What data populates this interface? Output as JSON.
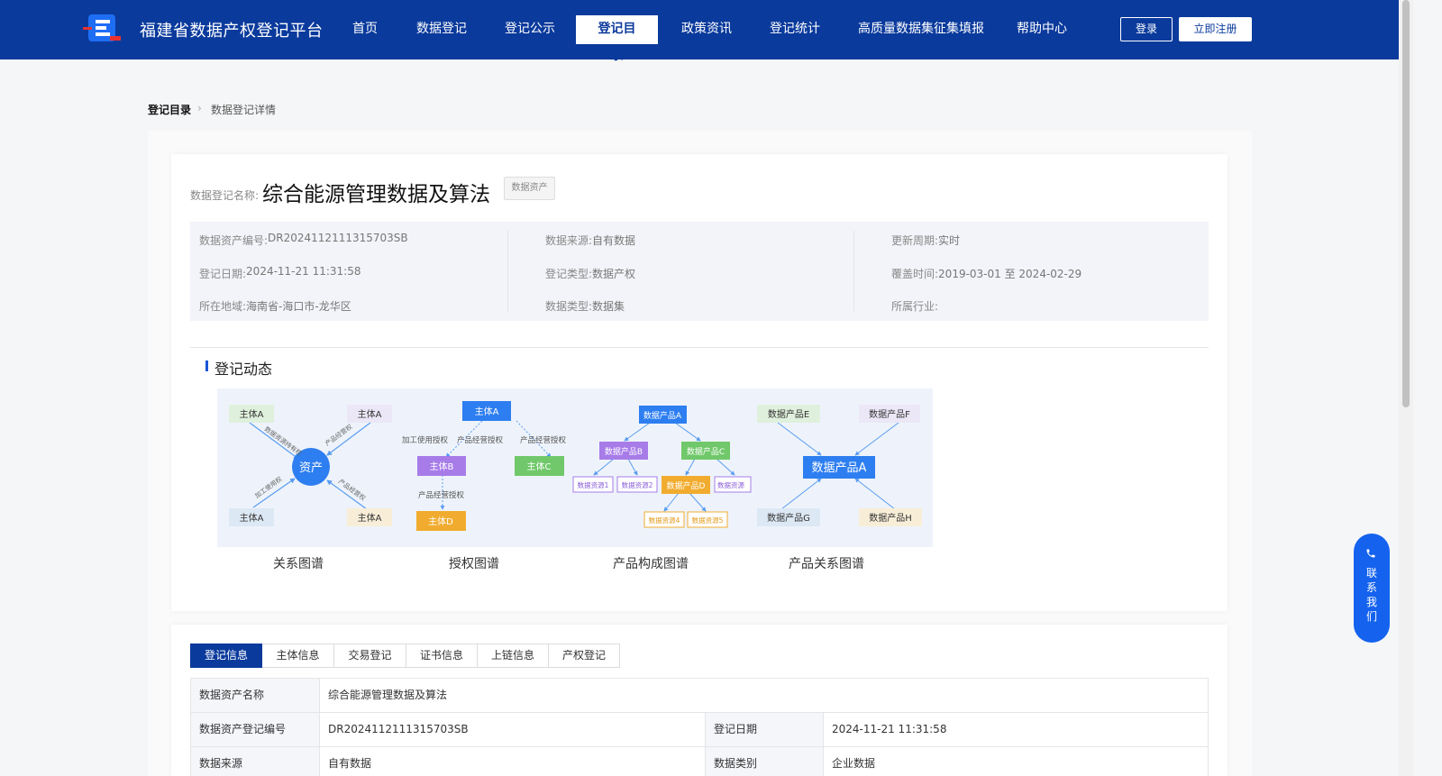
{
  "header": {
    "brand": "福建省数据产权登记平台",
    "nav": [
      "首页",
      "数据登记",
      "登记公示",
      "登记目录",
      "政策资讯",
      "登记统计",
      "高质量数据集征集填报",
      "帮助中心"
    ],
    "active_nav": "登记目录",
    "login": "登录",
    "register": "立即注册"
  },
  "breadcrumb": {
    "root": "登记目录",
    "current": "数据登记详情",
    "sep": "›"
  },
  "record": {
    "name_label": "数据登记名称:",
    "name": "综合能源管理数据及算法",
    "tag": "数据资产",
    "fields": {
      "asset_no_label": "数据资产编号:",
      "asset_no": "DR2024112111315703SB",
      "source_label": "数据来源:",
      "source": "自有数据",
      "cycle_label": "更新周期:",
      "cycle": "实时",
      "reg_date_label": "登记日期:",
      "reg_date": "2024-11-21 11:31:58",
      "reg_type_label": "登记类型:",
      "reg_type": "数据产权",
      "cover_label": "覆盖时间:",
      "cover": "2019-03-01 至 2024-02-29",
      "region_label": "所在地域:",
      "region": "海南省-海口市-龙华区",
      "data_type_label": "数据类型:",
      "data_type": "数据集",
      "industry_label": "所属行业:",
      "industry": ""
    }
  },
  "dynamics": {
    "title": "登记动态",
    "captions": [
      "关系图谱",
      "授权图谱",
      "产品构成图谱",
      "产品关系图谱"
    ],
    "relation": {
      "center": "资产",
      "nodes": [
        "主体A",
        "主体A",
        "主体A",
        "主体A"
      ],
      "edges": [
        "数据资源持有权",
        "产品经营权",
        "加工使用权",
        "产品经营权"
      ]
    },
    "auth": {
      "nodes": [
        "主体A",
        "主体B",
        "主体C",
        "主体D"
      ],
      "edges": [
        "加工使用授权",
        "产品经营授权",
        "产品经营授权",
        "产品经营授权"
      ]
    },
    "compose": {
      "nodes": [
        "数据产品A",
        "数据产品B",
        "数据产品C",
        "数据资源1",
        "数据资源2",
        "数据产品D",
        "数据资源",
        "数据资源4",
        "数据资源5"
      ]
    },
    "product_rel": {
      "center": "数据产品A",
      "nodes": [
        "数据产品E",
        "数据产品F",
        "数据产品G",
        "数据产品H"
      ]
    }
  },
  "contact": {
    "label": "联系我们"
  },
  "tabs": [
    "登记信息",
    "主体信息",
    "交易登记",
    "证书信息",
    "上链信息",
    "产权登记"
  ],
  "active_tab": "登记信息",
  "table": {
    "r1": {
      "l1": "数据资产名称",
      "v1": "综合能源管理数据及算法"
    },
    "r2": {
      "l1": "数据资产登记编号",
      "v1": "DR2024112111315703SB",
      "l2": "登记日期",
      "v2": "2024-11-21 11:31:58"
    },
    "r3": {
      "l1": "数据来源",
      "v1": "自有数据",
      "l2": "数据类别",
      "v2": "企业数据"
    }
  }
}
